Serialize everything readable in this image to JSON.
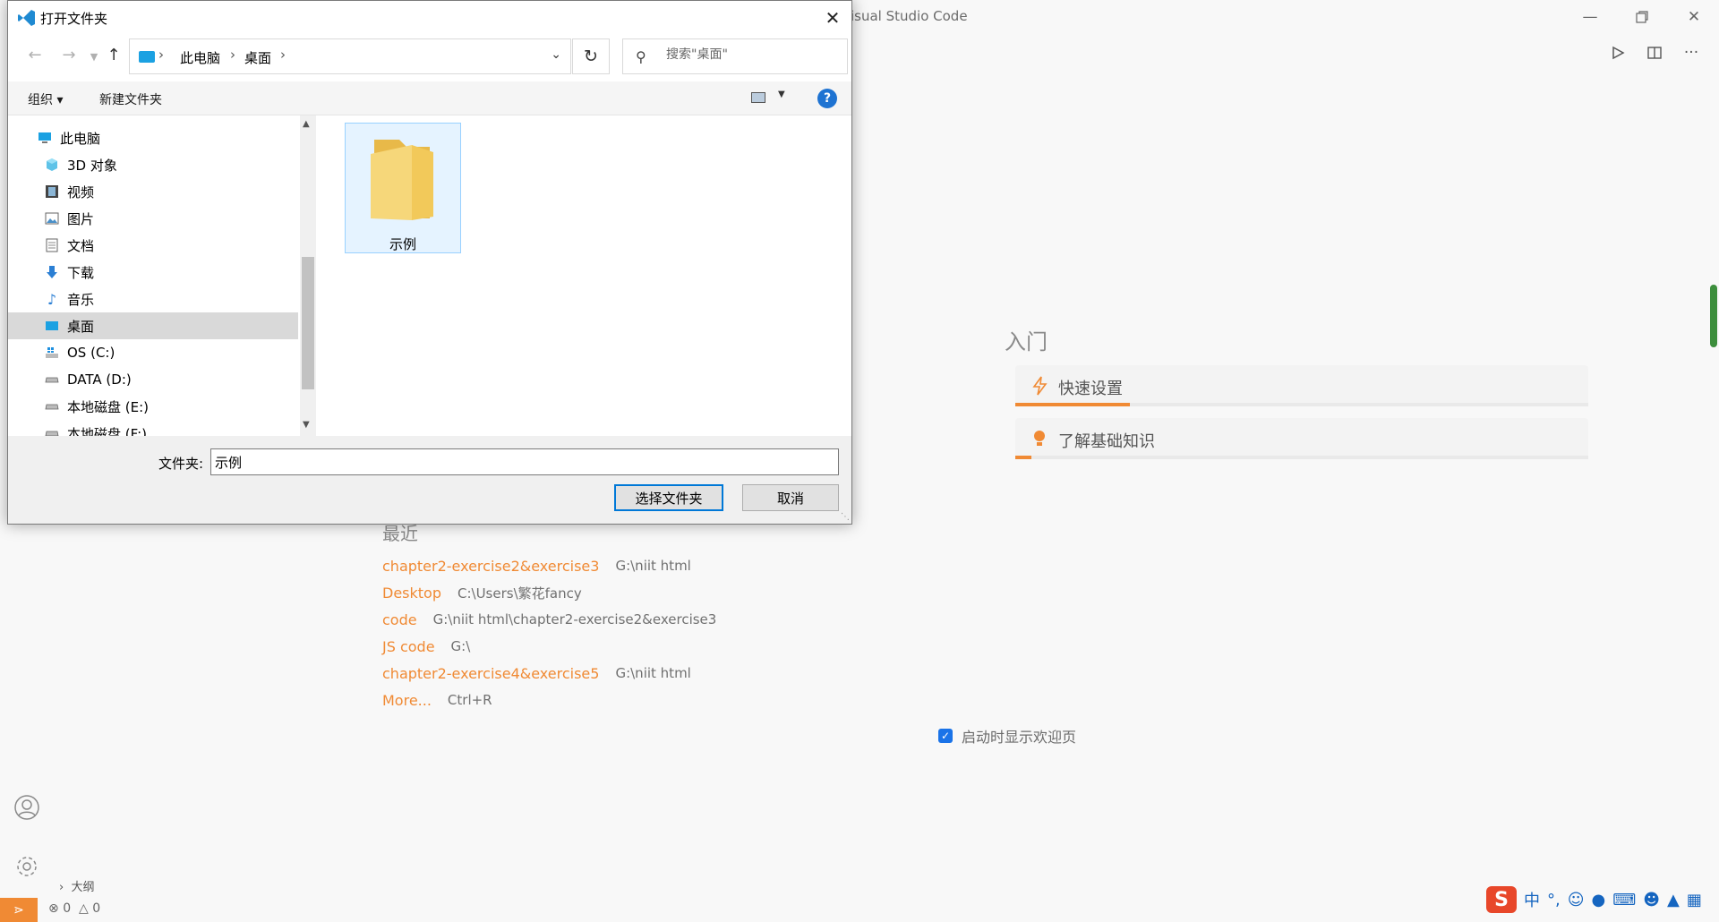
{
  "vscode": {
    "title_fragment": "isual Studio Code",
    "get_started": {
      "title": "入门",
      "walkthroughs": [
        {
          "label": "快速设置",
          "progress": 0.2
        },
        {
          "label": "了解基础知识",
          "progress": 0.03
        }
      ]
    },
    "recent": {
      "title": "最近",
      "items": [
        {
          "name": "chapter2-exercise2&exercise3",
          "path": "G:\\niit html"
        },
        {
          "name": "Desktop",
          "path": "C:\\Users\\繁花fancy"
        },
        {
          "name": "code",
          "path": "G:\\niit html\\chapter2-exercise2&exercise3"
        },
        {
          "name": "JS code",
          "path": "G:\\"
        },
        {
          "name": "chapter2-exercise4&exercise5",
          "path": "G:\\niit html"
        },
        {
          "name": "More...",
          "path": "Ctrl+R"
        }
      ]
    },
    "startup_checkbox": "启动时显示欢迎页",
    "outline": "大纲",
    "status": {
      "errors": "0",
      "warnings": "0"
    },
    "ime": {
      "mode": "中"
    }
  },
  "dialog": {
    "title": "打开文件夹",
    "breadcrumb": [
      "此电脑",
      "桌面"
    ],
    "search_placeholder": "搜索\"桌面\"",
    "commands": {
      "organize": "组织 ▾",
      "new_folder": "新建文件夹"
    },
    "tree": [
      {
        "label": "此电脑",
        "icon": "pc-icon"
      },
      {
        "label": "3D 对象",
        "icon": "cube-icon"
      },
      {
        "label": "视频",
        "icon": "film-icon"
      },
      {
        "label": "图片",
        "icon": "picture-icon"
      },
      {
        "label": "文档",
        "icon": "document-icon"
      },
      {
        "label": "下载",
        "icon": "download-icon"
      },
      {
        "label": "音乐",
        "icon": "music-icon"
      },
      {
        "label": "桌面",
        "icon": "desktop-icon",
        "selected": true
      },
      {
        "label": "OS (C:)",
        "icon": "windows-drive-icon"
      },
      {
        "label": "DATA (D:)",
        "icon": "drive-icon"
      },
      {
        "label": "本地磁盘 (E:)",
        "icon": "drive-icon"
      },
      {
        "label": "本地磁盘 (F:)",
        "icon": "drive-icon"
      }
    ],
    "files": [
      {
        "name": "示例",
        "icon": "folder-icon"
      }
    ],
    "folder_label": "文件夹:",
    "folder_value": "示例",
    "select_button": "选择文件夹",
    "cancel_button": "取消"
  }
}
